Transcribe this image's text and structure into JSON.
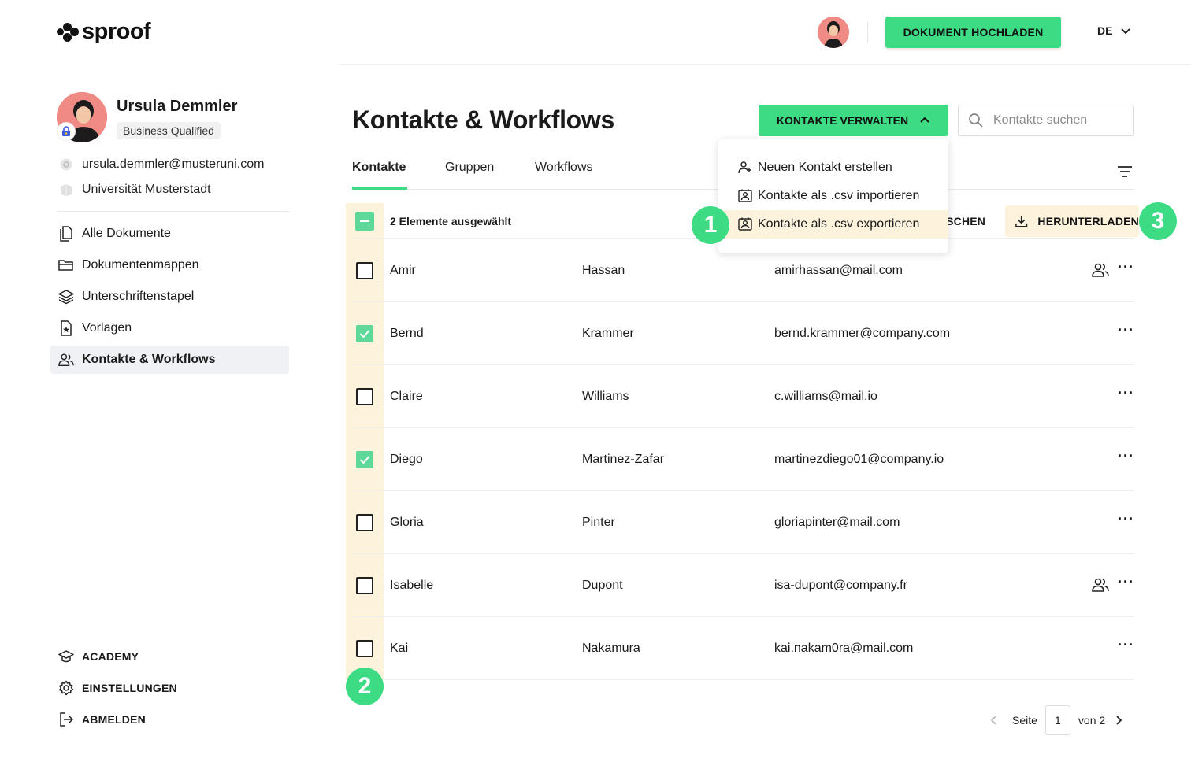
{
  "brand": {
    "name": "sproof"
  },
  "header": {
    "upload_label": "DOKUMENT HOCHLADEN",
    "language": "DE"
  },
  "profile": {
    "name": "Ursula Demmler",
    "badge": "Business Qualified",
    "email": "ursula.demmler@musteruni.com",
    "organization": "Universität Musterstadt"
  },
  "sidebar": {
    "items": [
      {
        "label": "Alle Dokumente",
        "icon": "document-icon"
      },
      {
        "label": "Dokumentenmappen",
        "icon": "folder-icon"
      },
      {
        "label": "Unterschriftenstapel",
        "icon": "stack-icon"
      },
      {
        "label": "Vorlagen",
        "icon": "template-icon"
      },
      {
        "label": "Kontakte & Workflows",
        "icon": "contacts-icon",
        "active": true
      }
    ],
    "footer": [
      {
        "label": "ACADEMY",
        "icon": "graduation-cap-icon"
      },
      {
        "label": "EINSTELLUNGEN",
        "icon": "gear-icon"
      },
      {
        "label": "ABMELDEN",
        "icon": "logout-icon"
      }
    ]
  },
  "main": {
    "title": "Kontakte & Workflows",
    "manage_label": "KONTAKTE VERWALTEN",
    "search_placeholder": "Kontakte suchen",
    "tabs": [
      {
        "label": "Kontakte",
        "active": true
      },
      {
        "label": "Gruppen"
      },
      {
        "label": "Workflows"
      }
    ],
    "selection": {
      "label": "2 Elemente ausgewählt",
      "delete_label": "ÖSCHEN",
      "download_label": "HERUNTERLADEN"
    },
    "dropdown": [
      {
        "label": "Neuen Kontakt erstellen",
        "icon": "add-user-icon"
      },
      {
        "label": "Kontakte als .csv importieren",
        "icon": "import-icon"
      },
      {
        "label": "Kontakte als .csv exportieren",
        "icon": "export-icon",
        "highlighted": true
      }
    ],
    "contacts": [
      {
        "first": "Amir",
        "last": "Hassan",
        "email": "amirhassan@mail.com",
        "checked": false,
        "group": true
      },
      {
        "first": "Bernd",
        "last": "Krammer",
        "email": "bernd.krammer@company.com",
        "checked": true,
        "group": false
      },
      {
        "first": "Claire",
        "last": "Williams",
        "email": "c.williams@mail.io",
        "checked": false,
        "group": false
      },
      {
        "first": "Diego",
        "last": "Martinez-Zafar",
        "email": "martinezdiego01@company.io",
        "checked": true,
        "group": false
      },
      {
        "first": "Gloria",
        "last": "Pinter",
        "email": "gloriapinter@mail.com",
        "checked": false,
        "group": false
      },
      {
        "first": "Isabelle",
        "last": "Dupont",
        "email": "isa-dupont@company.fr",
        "checked": false,
        "group": true
      },
      {
        "first": "Kai",
        "last": "Nakamura",
        "email": "kai.nakam0ra@mail.com",
        "checked": false,
        "group": false
      }
    ],
    "pagination": {
      "page_label": "Seite",
      "current": "1",
      "of_label": "von 2"
    }
  },
  "steps": [
    "1",
    "2",
    "3"
  ],
  "colors": {
    "accent": "#3ddc84",
    "highlight": "#fdf3dd",
    "avatar": "#f08a85"
  }
}
